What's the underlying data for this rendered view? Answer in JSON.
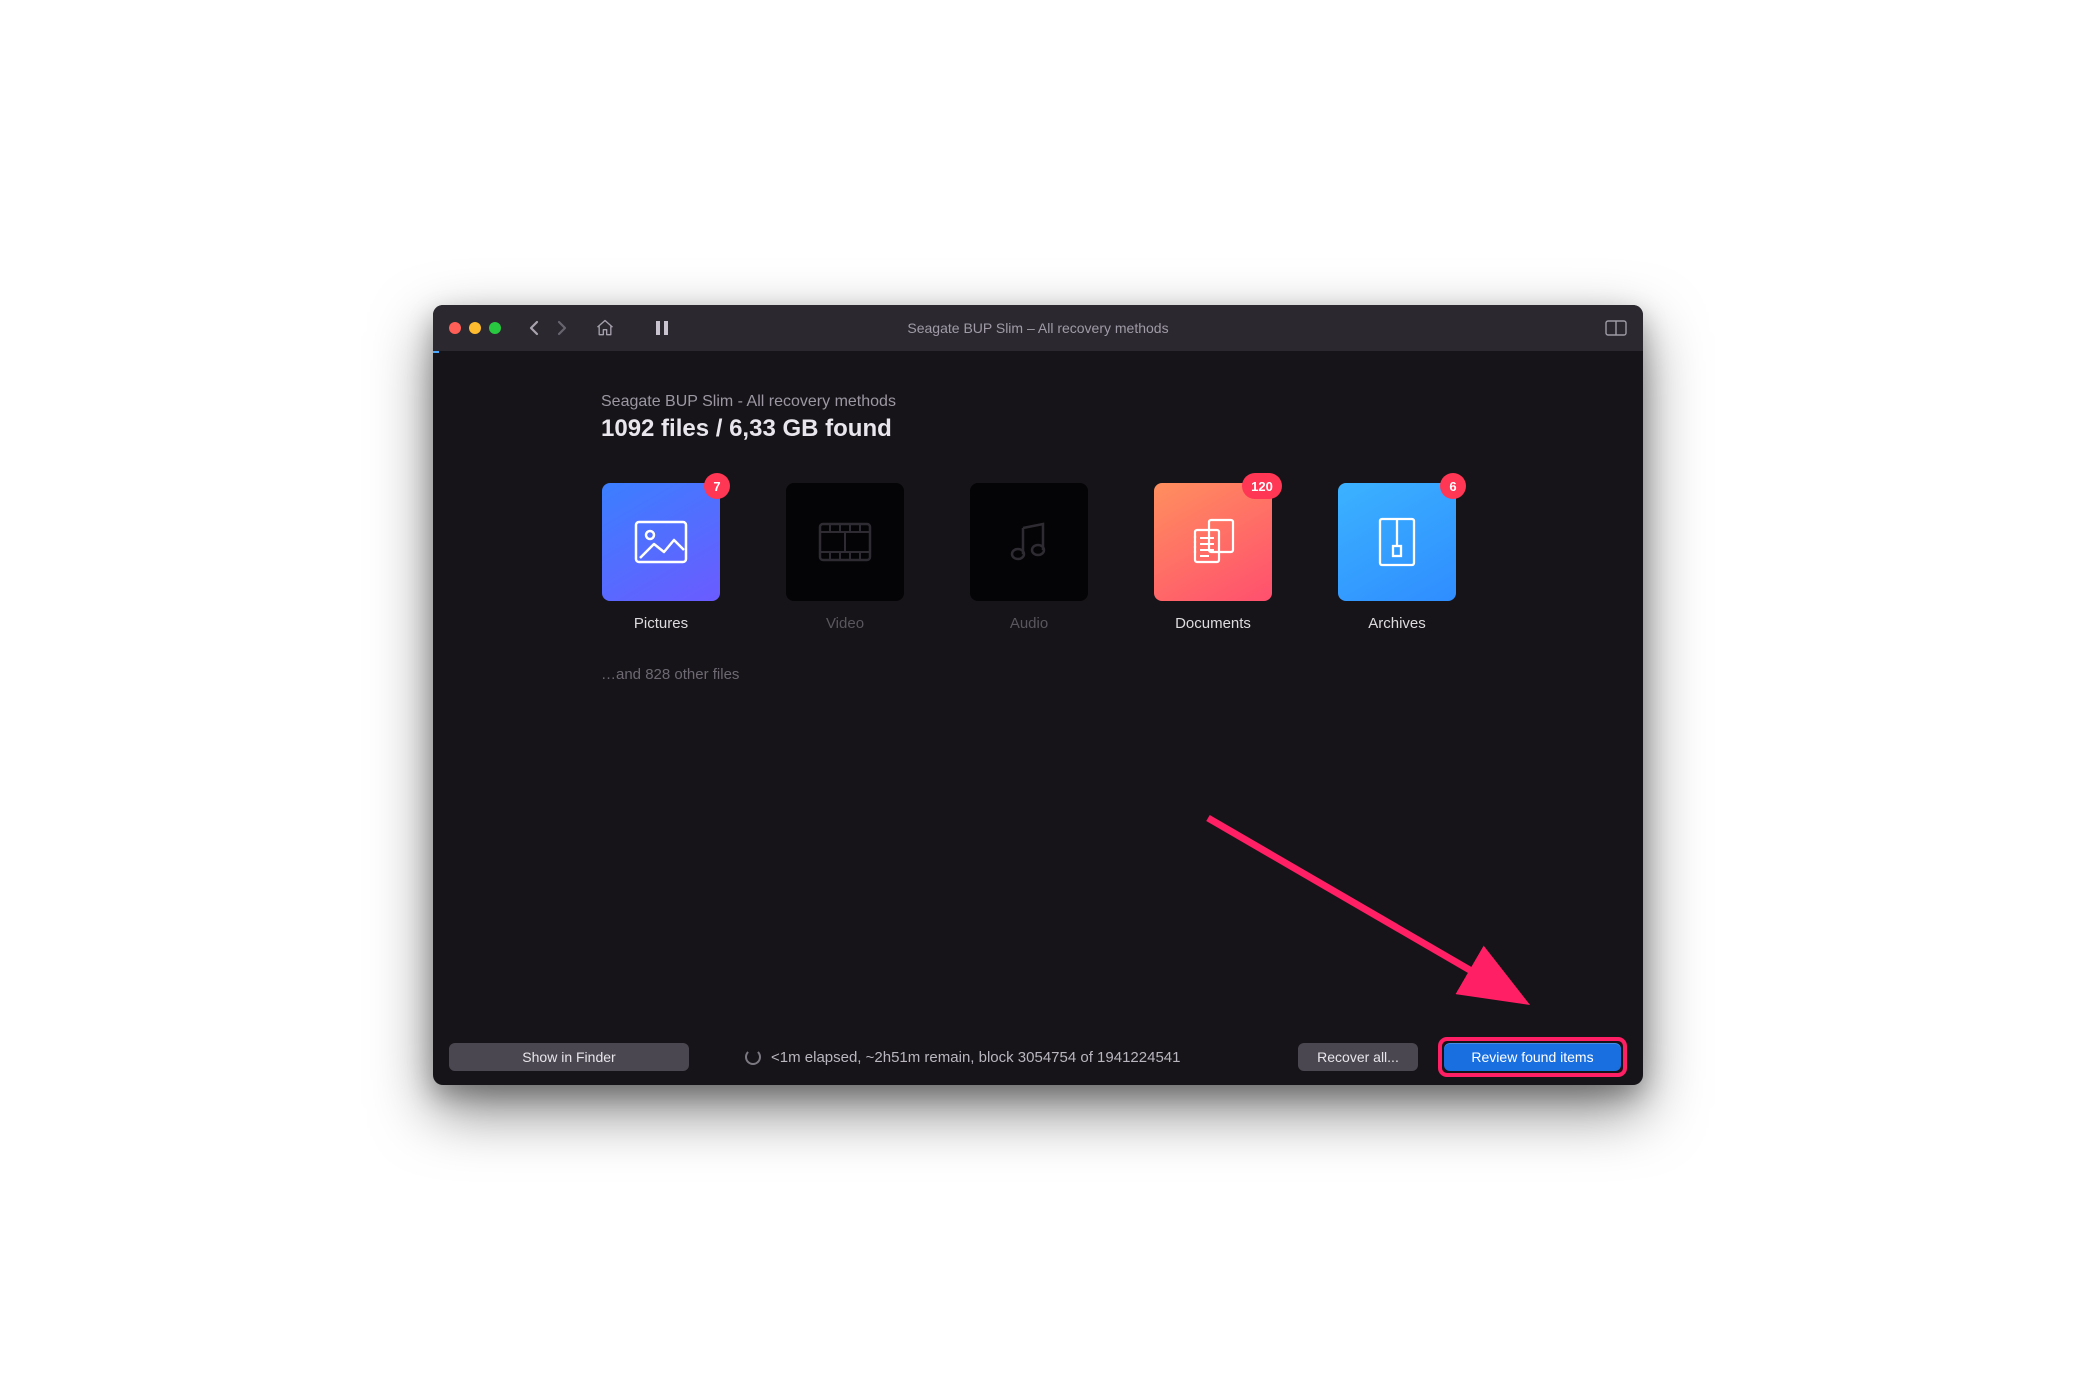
{
  "titlebar": {
    "title": "Seagate BUP Slim – All recovery methods"
  },
  "header": {
    "subtitle": "Seagate BUP Slim - All recovery methods",
    "found_heading": "1092 files / 6,33 GB found"
  },
  "categories": [
    {
      "id": "pictures",
      "label": "Pictures",
      "badge": "7",
      "style": "pictures",
      "dim": false
    },
    {
      "id": "video",
      "label": "Video",
      "badge": null,
      "style": "dark",
      "dim": true
    },
    {
      "id": "audio",
      "label": "Audio",
      "badge": null,
      "style": "dark",
      "dim": true
    },
    {
      "id": "documents",
      "label": "Documents",
      "badge": "120",
      "style": "documents",
      "dim": false
    },
    {
      "id": "archives",
      "label": "Archives",
      "badge": "6",
      "style": "archives",
      "dim": false
    }
  ],
  "other_files_text": "…and 828 other files",
  "footer": {
    "show_in_finder": "Show in Finder",
    "status": "<1m elapsed, ~2h51m remain, block 3054754 of 1941224541",
    "recover_all": "Recover all...",
    "review_found": "Review found items"
  }
}
